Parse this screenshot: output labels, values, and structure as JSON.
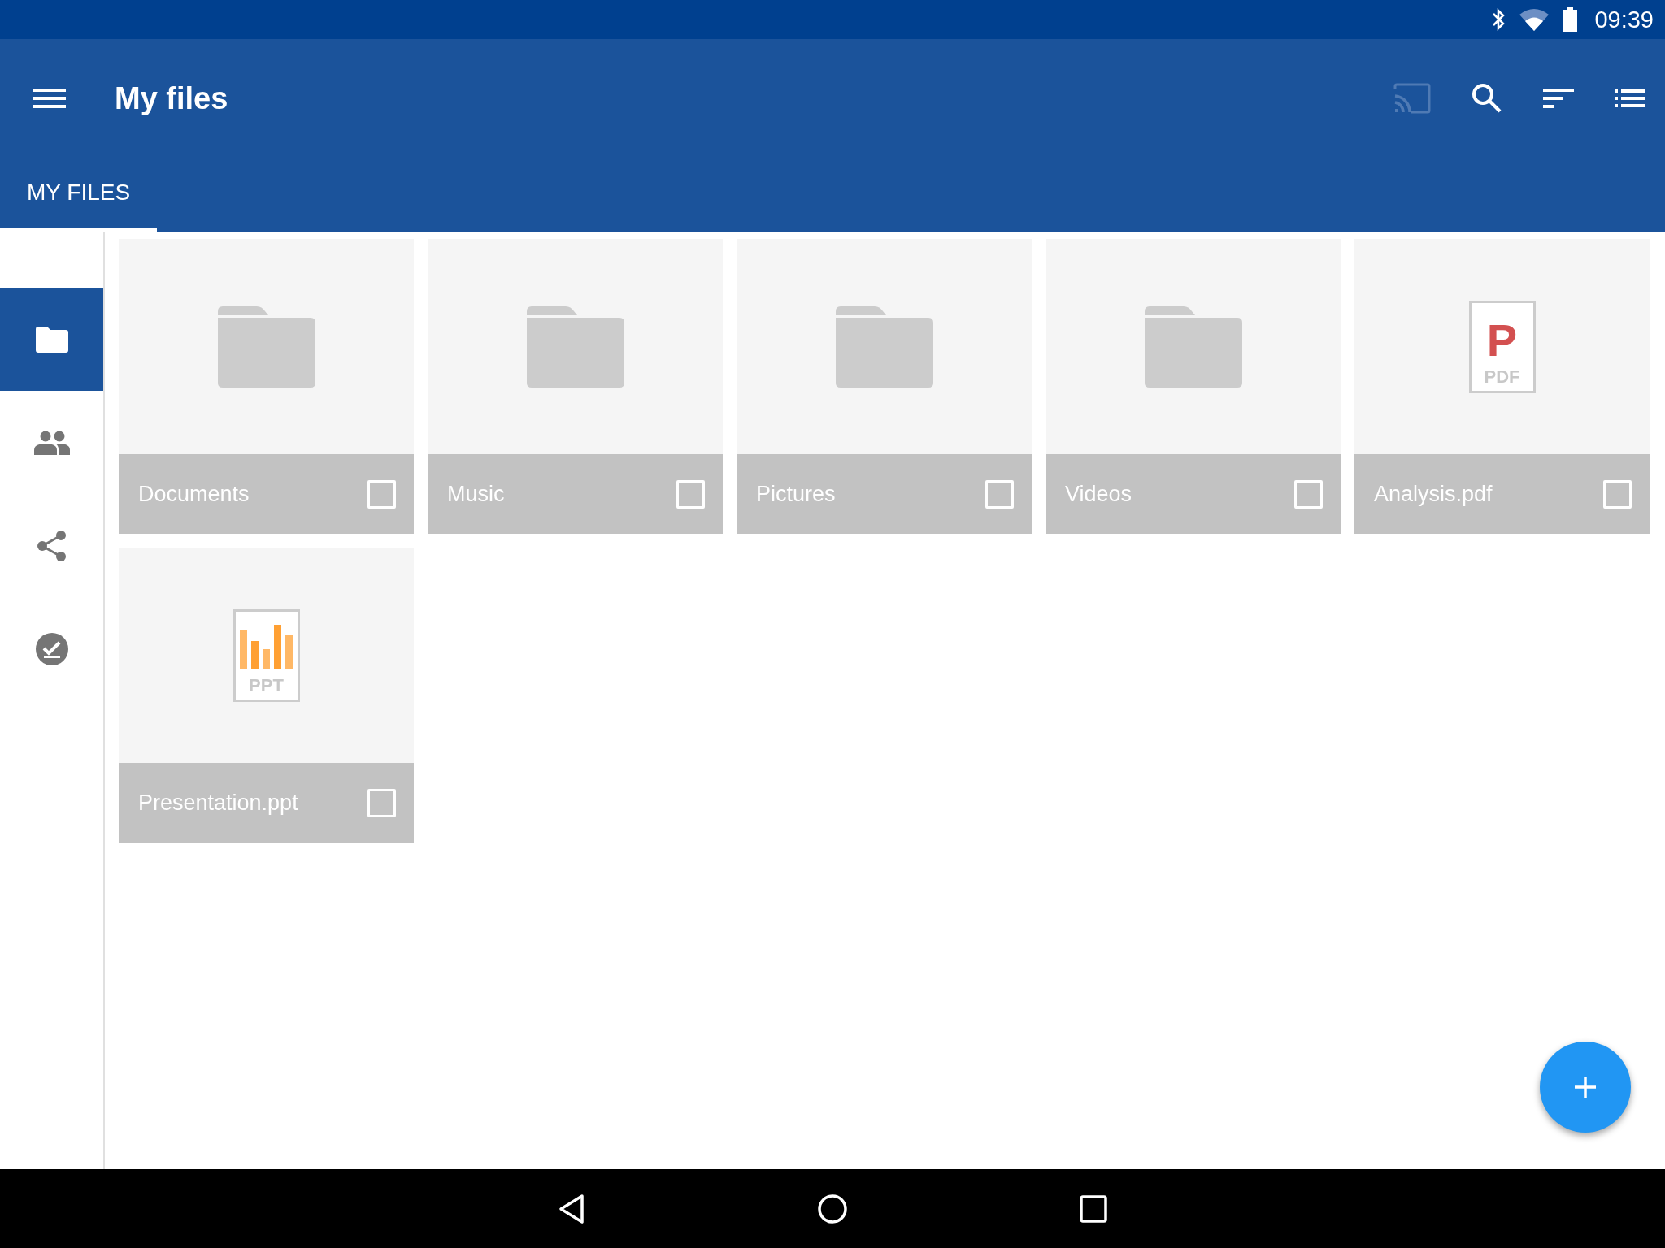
{
  "status_bar": {
    "time": "09:39"
  },
  "app_bar": {
    "title": "My files"
  },
  "tabs": [
    {
      "label": "MY FILES",
      "selected": true
    }
  ],
  "sidebar": {
    "items": [
      {
        "kind": "files",
        "selected": true
      },
      {
        "kind": "people",
        "selected": false
      },
      {
        "kind": "shared",
        "selected": false
      },
      {
        "kind": "tasks",
        "selected": false
      }
    ]
  },
  "files": [
    {
      "kind": "folder",
      "name": "Documents",
      "checked": false
    },
    {
      "kind": "folder",
      "name": "Music",
      "checked": false
    },
    {
      "kind": "folder",
      "name": "Pictures",
      "checked": false
    },
    {
      "kind": "folder",
      "name": "Videos",
      "checked": false
    },
    {
      "kind": "pdf",
      "name": "Analysis.pdf",
      "letter": "P",
      "badge": "PDF",
      "checked": false
    },
    {
      "kind": "ppt",
      "name": "Presentation.ppt",
      "badge": "PPT",
      "checked": false
    }
  ]
}
